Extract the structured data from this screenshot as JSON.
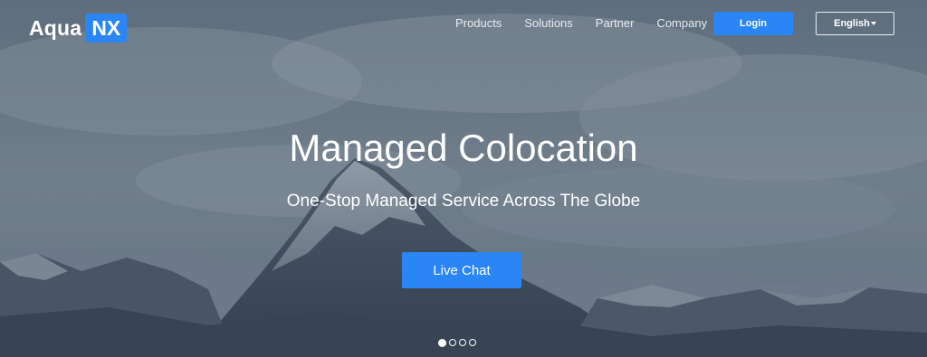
{
  "header": {
    "logo_text": "Aqua",
    "logo_badge": "NX",
    "nav": [
      {
        "label": "Products"
      },
      {
        "label": "Solutions"
      },
      {
        "label": "Partner"
      },
      {
        "label": "Company"
      }
    ],
    "login_label": "Login",
    "language_label": "English"
  },
  "hero": {
    "title": "Managed Colocation",
    "subtitle": "One-Stop Managed Service Across The Globe",
    "cta_label": "Live Chat",
    "background_icon": "mountain-landscape"
  },
  "carousel": {
    "slide_count": 4,
    "active_index": 0
  },
  "colors": {
    "accent": "#2a86f5",
    "text": "#ffffff"
  }
}
